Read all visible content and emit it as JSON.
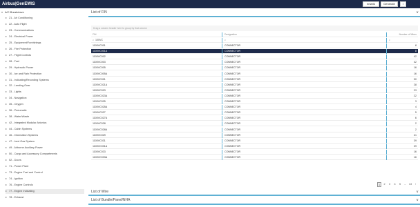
{
  "app": {
    "title": "Airbus|GenEWIS"
  },
  "toolbar": {
    "btn1": "enlarik",
    "btn2": "Generate",
    "btn3": "i"
  },
  "tree": {
    "root": "A/C Breakdown",
    "items": [
      "21 - Air Conditioning",
      "22 - Auto Flight",
      "23 - Communications",
      "24 - Electrical Power",
      "25 - Equipment/Furnishings",
      "26 - Fire Protection",
      "27 - Flight Controls",
      "28 - Fuel",
      "29 - Hydraulic Power",
      "30 - Ice and Rain Protection",
      "31 - Indicating/Recording Systems",
      "32 - Landing Gear",
      "33 - Lights",
      "34 - Navigation",
      "35 - Oxygen",
      "36 - Pneumatic",
      "38 - Water/Waste",
      "42 - Integrated Modular Avionics",
      "44 - Cabin Systems",
      "46 - Information Systems",
      "47 - Inert Gas System",
      "49 - Airborne Auxiliary Power",
      "50 - Cargo and Accessory Compartments",
      "52 - Doors",
      "71 - Power Plant",
      "73 - Engine Fuel and Control",
      "74 - Ignition",
      "76 - Engine Controls",
      "77 - Engine Indicating",
      "78 - Exhaust"
    ]
  },
  "fin_panel": {
    "title": "List of FIN",
    "grouping_hint": "Drag a column header here to group by that column",
    "columns": {
      "fin": "FIN",
      "designation": "Designation",
      "wires": "Number of Wires"
    },
    "filter_value": "100VC",
    "rows": [
      {
        "fin": "1100VC001",
        "designation": "CONNECTOR",
        "wires": "8"
      },
      {
        "fin": "1100VC001A",
        "designation": "CONNECTOR",
        "wires": "8"
      },
      {
        "fin": "1100VC002",
        "designation": "CONNECTOR",
        "wires": "42"
      },
      {
        "fin": "1100VC003",
        "designation": "CONNECTOR",
        "wires": "42"
      },
      {
        "fin": "1100VC005",
        "designation": "CONNECTOR",
        "wires": "16"
      },
      {
        "fin": "1100VC005A",
        "designation": "CONNECTOR",
        "wires": "16"
      },
      {
        "fin": "1100VC021",
        "designation": "CONNECTOR",
        "wires": "30"
      },
      {
        "fin": "1100VC021A",
        "designation": "CONNECTOR",
        "wires": "28"
      },
      {
        "fin": "1100VC023",
        "designation": "CONNECTOR",
        "wires": "23"
      },
      {
        "fin": "1100VC023A",
        "designation": "CONNECTOR",
        "wires": "22"
      },
      {
        "fin": "1100VC025",
        "designation": "CONNECTOR",
        "wires": "3"
      },
      {
        "fin": "1100VC025A",
        "designation": "CONNECTOR",
        "wires": "4"
      },
      {
        "fin": "1100VC027",
        "designation": "CONNECTOR",
        "wires": "5"
      },
      {
        "fin": "1100VC027A",
        "designation": "CONNECTOR",
        "wires": "6"
      },
      {
        "fin": "1100VC028",
        "designation": "CONNECTOR",
        "wires": "2"
      },
      {
        "fin": "1100VC028A",
        "designation": "CONNECTOR",
        "wires": "2"
      },
      {
        "fin": "1100VC029",
        "designation": "CONNECTOR",
        "wires": "41"
      },
      {
        "fin": "1100VC031",
        "designation": "CONNECTOR",
        "wires": "39"
      },
      {
        "fin": "1100VC031A",
        "designation": "CONNECTOR",
        "wires": "39"
      },
      {
        "fin": "1100VC033",
        "designation": "CONNECTOR",
        "wires": "16"
      },
      {
        "fin": "1100VC033A",
        "designation": "CONNECTOR",
        "wires": "16"
      }
    ],
    "selected_row": 1,
    "pager": {
      "pages": [
        "1",
        "2",
        "3",
        "4",
        "5",
        "...",
        "13"
      ],
      "next": "›",
      "active": 0
    }
  },
  "wire_panel": {
    "title": "List of Wire"
  },
  "bundle_panel": {
    "title": "List of Bundle/Panel/NHA"
  },
  "icons": {
    "expand": "chevron-down-icon",
    "tree_collapsed": "caret-right-icon",
    "tree_expanded": "caret-down-icon",
    "filter": "search-icon"
  }
}
